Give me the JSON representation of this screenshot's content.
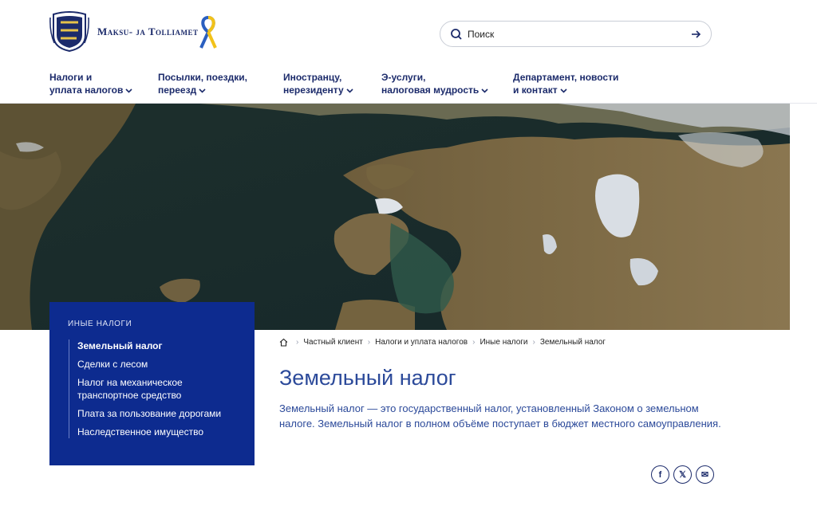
{
  "header": {
    "brand": "Maksu- ja Tolliamet",
    "search": {
      "placeholder": "Поиск"
    }
  },
  "nav": [
    {
      "line1": "Налоги и",
      "line2": "уплата налогов"
    },
    {
      "line1": "Посылки, поездки,",
      "line2": "переезд"
    },
    {
      "line1": "Иностранцу,",
      "line2": "нерезиденту"
    },
    {
      "line1": "Э-услуги,",
      "line2": "налоговая мудрость"
    },
    {
      "line1": "Департамент, новости",
      "line2": "и контакт"
    }
  ],
  "sidebar": {
    "title": "Иные налоги",
    "items": [
      {
        "label": "Земельный налог"
      },
      {
        "label": "Сделки с лесом"
      },
      {
        "label": "Налог на механическое транспортное средство"
      },
      {
        "label": "Плата за пользование дорогами"
      },
      {
        "label": "Наследственное имущество"
      }
    ]
  },
  "breadcrumb": [
    "Частный клиент",
    "Налоги и уплата налогов",
    "Иные налоги",
    "Земельный налог"
  ],
  "main": {
    "title": "Земельный налог",
    "lead": "Земельный налог — это государственный налог, установленный Законом о земельном налоге. Земельный налог в полном объёме поступает в бюджет местного самоуправления."
  },
  "share": {
    "facebook_icon": "f",
    "x_icon": "𝕏",
    "email_icon": "✉"
  },
  "colors": {
    "primary": "#1c2b6b",
    "sidebar_bg": "#0d2b8f",
    "title_blue": "#2c4a9a"
  }
}
